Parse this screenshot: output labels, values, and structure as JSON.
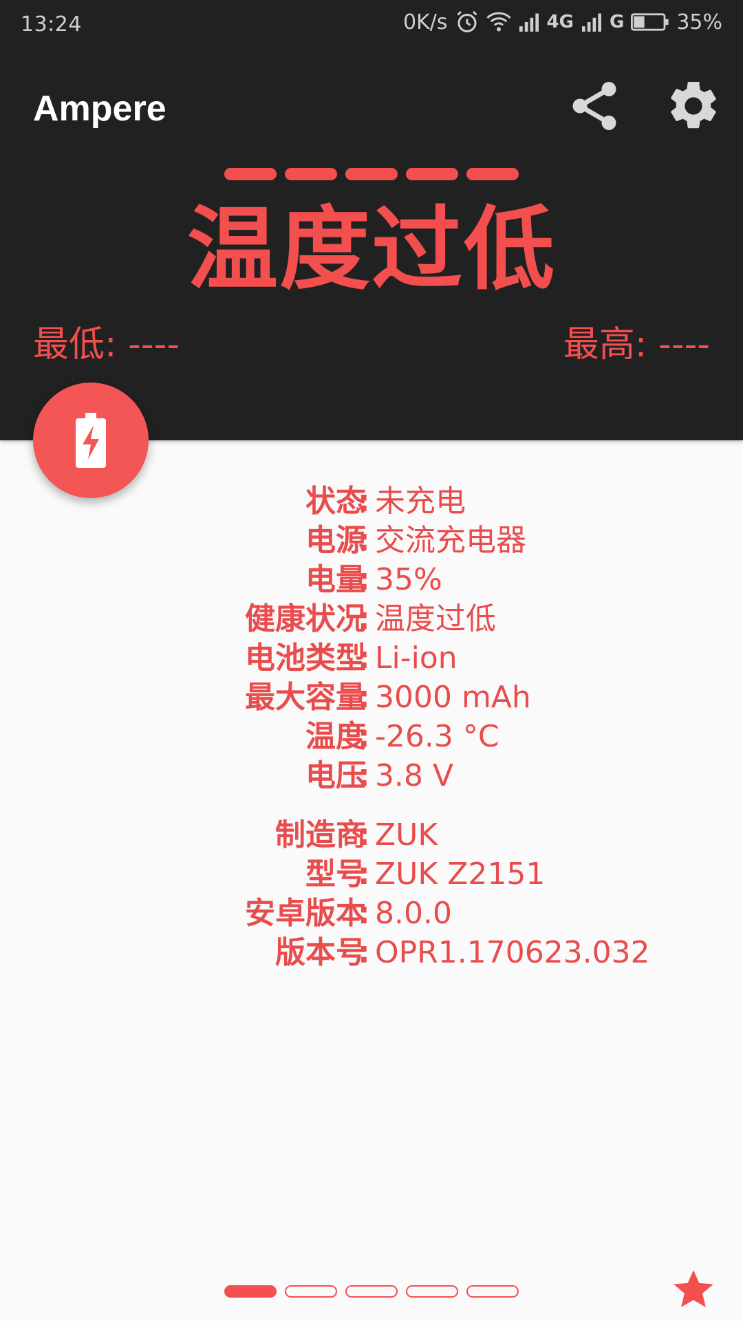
{
  "status_bar": {
    "time": "13:24",
    "net_speed": "0K/s",
    "sim1_type": "4G",
    "sim2_type": "G",
    "battery_percent": "35%"
  },
  "app": {
    "title": "Ampere",
    "accent_color": "#f44f4f",
    "header_color": "#212121"
  },
  "hero": {
    "health_status": "温度过低",
    "min_label": "最低: ----",
    "max_label": "最高: ----"
  },
  "battery_info": [
    {
      "key": "状态",
      "value": "未充电"
    },
    {
      "key": "电源",
      "value": "交流充电器"
    },
    {
      "key": "电量",
      "value": "35%"
    },
    {
      "key": "健康状况",
      "value": "温度过低"
    },
    {
      "key": "电池类型",
      "value": "Li-ion"
    },
    {
      "key": "最大容量",
      "value": "3000 mAh"
    },
    {
      "key": "温度",
      "value": "-26.3 °C"
    },
    {
      "key": "电压",
      "value": "3.8 V"
    }
  ],
  "device_info": [
    {
      "key": "制造商",
      "value": "ZUK"
    },
    {
      "key": "型号",
      "value": "ZUK Z2151"
    },
    {
      "key": "安卓版本",
      "value": "8.0.0"
    },
    {
      "key": "版本号",
      "value": "OPR1.170623.032"
    }
  ],
  "colon": ":",
  "icons": {
    "share": "share-icon",
    "settings": "gear-icon",
    "fab": "battery-charging-icon",
    "rate": "star-icon"
  }
}
